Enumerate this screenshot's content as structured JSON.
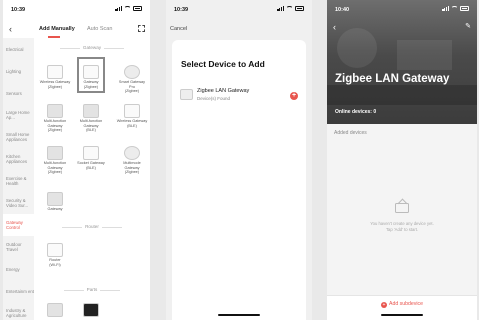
{
  "screen1": {
    "time": "10:39",
    "back_icon": "chevron-left-icon",
    "tab_manual": "Add Manually",
    "tab_auto": "Auto Scan",
    "categories": [
      "Electrical",
      "Lighting",
      "Sensors",
      "Large Home Ap...",
      "Small Home Appliances",
      "Kitchen Appliances",
      "Exercise & Health",
      "Security & Video Sur...",
      "Gateway Control",
      "Outdoor Travel",
      "Energy",
      "Entertainm ent",
      "Industry & Agriculture"
    ],
    "active_category": "Gateway Control",
    "section_gateway": "Gateway",
    "section_router": "Router",
    "section_parts": "Parts",
    "devices": [
      {
        "l1": "Wireless Gateway",
        "l2": "(Zigbee)"
      },
      {
        "l1": "Gateway",
        "l2": "(Zigbee)"
      },
      {
        "l1": "Smart Gateway",
        "l2": "Pro",
        "l3": "(Zigbee)"
      },
      {
        "l1": "Multi-function",
        "l2": "Gateway",
        "l3": "(Zigbee)"
      },
      {
        "l1": "Multi-function",
        "l2": "Gateway",
        "l3": "(BLE)"
      },
      {
        "l1": "Wireless Gateway",
        "l2": "(BLE)"
      },
      {
        "l1": "Multi-function",
        "l2": "Gateway",
        "l3": "(Zigbee)"
      },
      {
        "l1": "Socket Gateway",
        "l2": "(BLE)"
      },
      {
        "l1": "Multimode",
        "l2": "Gateway",
        "l3": "(Zigbee)"
      },
      {
        "l1": "Gateway"
      }
    ],
    "router": {
      "l1": "Router",
      "l2": "(Wi-Fi)"
    }
  },
  "screen2": {
    "time": "10:39",
    "cancel": "Cancel",
    "title": "Select Device to Add",
    "device_name": "Zigbee LAN Gateway",
    "device_found": "Device(s) Found",
    "add_icon": "plus-icon"
  },
  "screen3": {
    "time": "10:40",
    "title": "Zigbee LAN Gateway",
    "online_label": "Online devices:",
    "online_count": "0",
    "added_devices": "Added devices",
    "empty_line1": "You haven't create any device yet.",
    "empty_line2": "Tap 'Add' to start.",
    "add_subdevice": "Add subdevice"
  },
  "colors": {
    "accent": "#e8554e"
  }
}
